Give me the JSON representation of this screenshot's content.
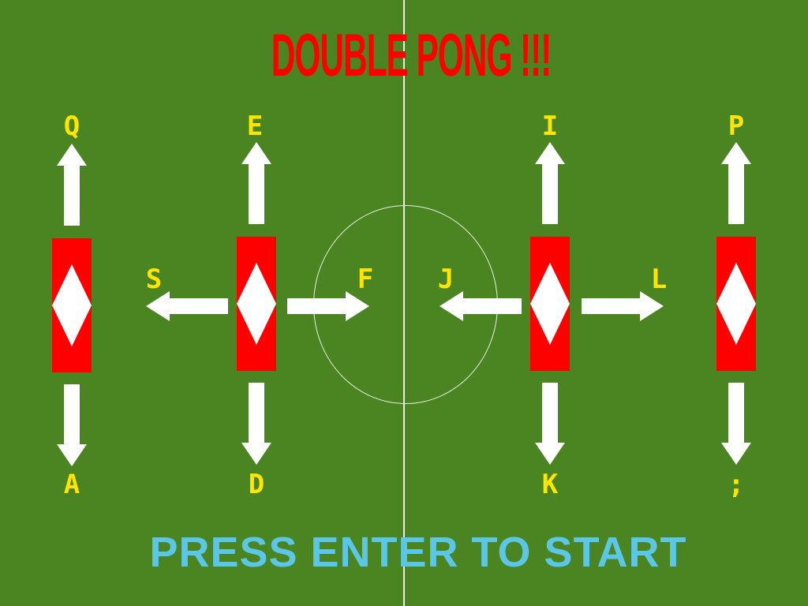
{
  "title": "DOUBLE PONG !!!",
  "start_prompt": "PRESS ENTER TO START",
  "colors": {
    "field": "#4a8521",
    "line": "#e6efe0",
    "title": "#ff0000",
    "paddle": "#ff0000",
    "diamond": "#ffffff",
    "key_label": "#ffe500",
    "prompt": "#5bc6e6",
    "arrow": "#ffffff"
  },
  "controls": {
    "paddle_1": {
      "up": "Q",
      "down": "A"
    },
    "paddle_2": {
      "up": "E",
      "down": "D",
      "left": "S",
      "right": "F"
    },
    "paddle_3": {
      "up": "I",
      "down": "K",
      "left": "J",
      "right": "L"
    },
    "paddle_4": {
      "up": "P",
      "down": ";"
    }
  }
}
